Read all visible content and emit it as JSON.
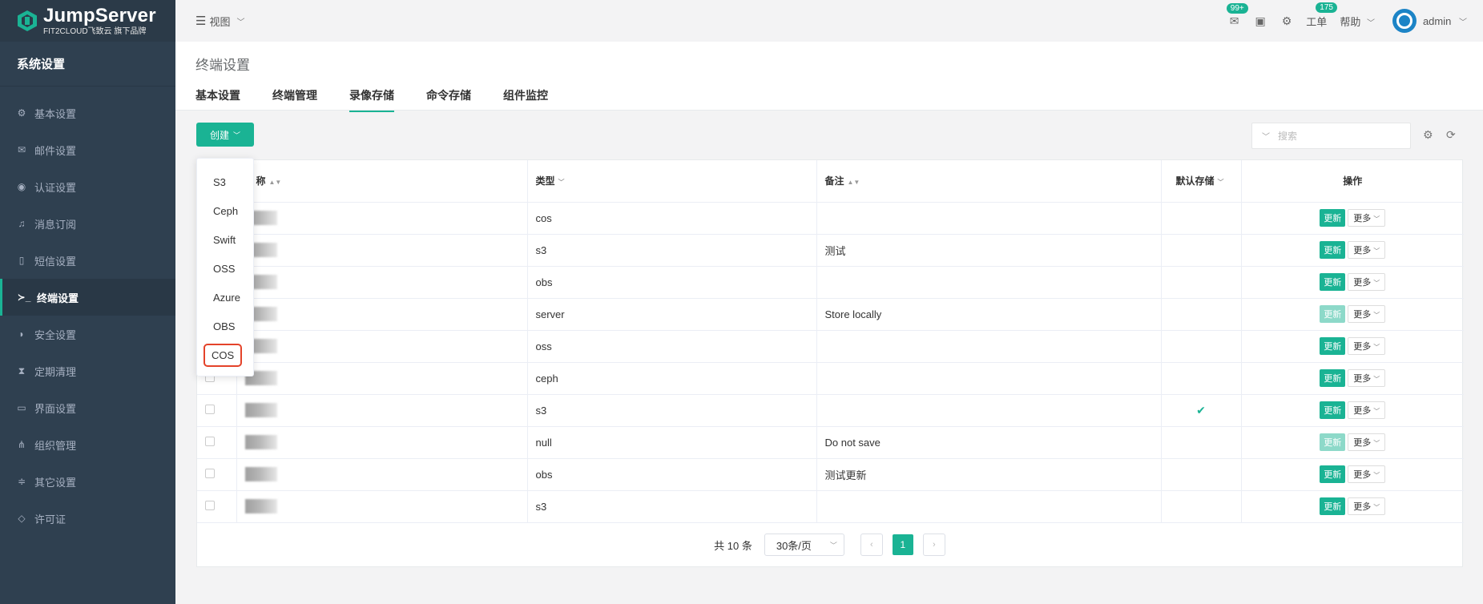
{
  "app": {
    "logo_title": "JumpServer",
    "logo_sub": "FIT2CLOUD飞致云 旗下品牌",
    "brand_color": "#1ab394",
    "sidebar_bg": "#2f4050"
  },
  "sidebar": {
    "header": "系统设置",
    "items": [
      {
        "icon": "gear-icon",
        "glyph": "⚙",
        "label": "基本设置"
      },
      {
        "icon": "envelope-icon",
        "glyph": "✉",
        "label": "邮件设置"
      },
      {
        "icon": "user-circle-icon",
        "glyph": "◉",
        "label": "认证设置"
      },
      {
        "icon": "bell-icon",
        "glyph": "♫",
        "label": "消息订阅"
      },
      {
        "icon": "mobile-icon",
        "glyph": "▯",
        "label": "短信设置"
      },
      {
        "icon": "terminal-icon",
        "glyph": "≻_",
        "label": "终端设置"
      },
      {
        "icon": "shield-icon",
        "glyph": "◗",
        "label": "安全设置"
      },
      {
        "icon": "hourglass-icon",
        "glyph": "⧗",
        "label": "定期清理"
      },
      {
        "icon": "laptop-icon",
        "glyph": "▭",
        "label": "界面设置"
      },
      {
        "icon": "sitemap-icon",
        "glyph": "⋔",
        "label": "组织管理"
      },
      {
        "icon": "sliders-icon",
        "glyph": "≑",
        "label": "其它设置"
      },
      {
        "icon": "diamond-icon",
        "glyph": "◇",
        "label": "许可证"
      }
    ]
  },
  "topbar": {
    "view_label": "视图",
    "mail_badge": "99+",
    "ticket_badge": "175",
    "ticket_label": "工单",
    "help_label": "帮助",
    "username": "admin"
  },
  "page": {
    "title": "终端设置",
    "tabs": [
      "基本设置",
      "终端管理",
      "录像存储",
      "命令存储",
      "组件监控"
    ],
    "active_tab": "录像存储"
  },
  "toolbar": {
    "create_label": "创建",
    "search_placeholder": "搜索"
  },
  "dropdown": {
    "items": [
      "S3",
      "Ceph",
      "Swift",
      "OSS",
      "Azure",
      "OBS",
      "COS"
    ],
    "highlighted": "COS"
  },
  "table": {
    "headers": {
      "name": "称",
      "type": "类型",
      "comment": "备注",
      "default": "默认存储",
      "actions": "操作"
    },
    "update_label": "更新",
    "more_label": "更多",
    "rows": [
      {
        "type": "cos",
        "comment": "",
        "default": false,
        "update_disabled": false
      },
      {
        "type": "s3",
        "comment": "测试",
        "default": false,
        "update_disabled": false
      },
      {
        "type": "obs",
        "comment": "",
        "default": false,
        "update_disabled": false
      },
      {
        "type": "server",
        "comment": "Store locally",
        "default": false,
        "update_disabled": true
      },
      {
        "type": "oss",
        "comment": "",
        "default": false,
        "update_disabled": false
      },
      {
        "type": "ceph",
        "comment": "",
        "default": false,
        "update_disabled": false
      },
      {
        "type": "s3",
        "comment": "",
        "default": true,
        "update_disabled": false
      },
      {
        "type": "null",
        "comment": "Do not save",
        "default": false,
        "update_disabled": true
      },
      {
        "type": "obs",
        "comment": "测试更新",
        "default": false,
        "update_disabled": false
      },
      {
        "type": "s3",
        "comment": "",
        "default": false,
        "update_disabled": false
      }
    ]
  },
  "pagination": {
    "total_text": "共 10 条",
    "page_size": "30条/页",
    "current_page": "1"
  }
}
